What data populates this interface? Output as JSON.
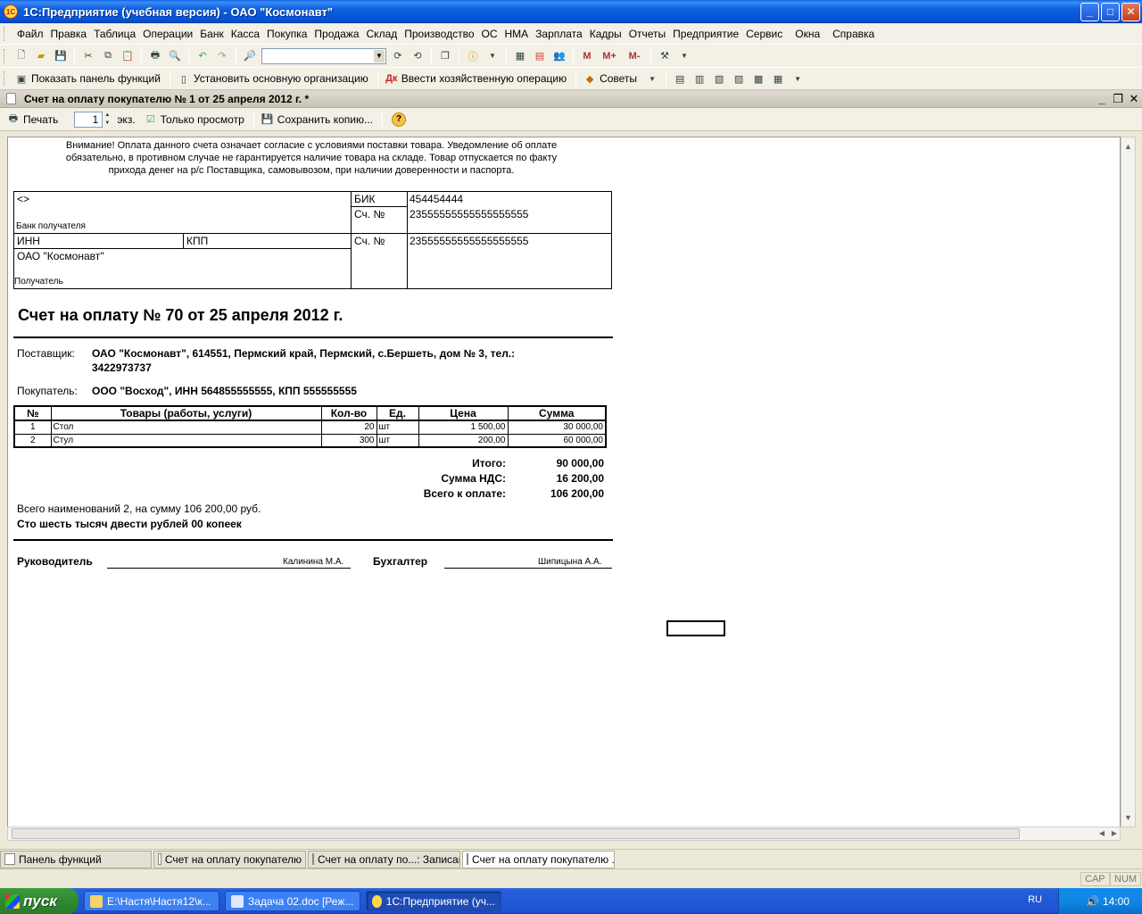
{
  "window": {
    "title": "1С:Предприятие (учебная версия) - ОАО \"Космонавт\"",
    "min": "_",
    "max": "□",
    "close": "✕"
  },
  "menu": [
    "Файл",
    "Правка",
    "Таблица",
    "Операции",
    "Банк",
    "Касса",
    "Покупка",
    "Продажа",
    "Склад",
    "Производство",
    "ОС",
    "НМА",
    "Зарплата",
    "Кадры",
    "Отчеты",
    "Предприятие",
    "Сервис",
    "Окна",
    "Справка"
  ],
  "toolbar2": {
    "show_panel": "Показать панель функций",
    "set_org": "Установить основную организацию",
    "enter_op": "Ввести хозяйственную операцию",
    "tips": "Советы"
  },
  "toolbar1": {
    "m": "M",
    "mplus": "M+",
    "mminus": "M-"
  },
  "doc": {
    "title": "Счет на оплату покупателю № 1 от 25 апреля 2012 г. *",
    "print": "Печать",
    "copies": "1",
    "copies_unit": "экз.",
    "readonly": "Только просмотр",
    "save_copy": "Сохранить копию...",
    "help": "?"
  },
  "invoice": {
    "notice": [
      "Внимание! Оплата данного счета означает согласие с условиями поставки товара. Уведомление об оплате",
      "обязательно, в противном случае не гарантируется наличие товара на складе. Товар отпускается по факту",
      "прихода денег на р/с Поставщика, самовывозом, при наличии доверенности и паспорта."
    ],
    "bank": {
      "bank_name": "<>",
      "bank_label": "Банк получателя",
      "bik_label": "БИК",
      "bik": "454454444",
      "acc_label": "Сч. №",
      "corr_acc": "23555555555555555555",
      "inn_label": "ИНН",
      "kpp_label": "КПП",
      "recipient_name": "ОАО \"Космонавт\"",
      "recipient_label": "Получатель",
      "acc_label2": "Сч. №",
      "acc": "23555555555555555555"
    },
    "title": "Счет на оплату № 70 от 25 апреля 2012 г.",
    "supplier_label": "Поставщик:",
    "supplier_line1": "ОАО \"Космонавт\", 614551, Пермский край, Пермский, с.Бершеть, дом № 3, тел.:",
    "supplier_line2": "3422973737",
    "buyer_label": "Покупатель:",
    "buyer": "ООО \"Восход\", ИНН 564855555555, КПП 555555555",
    "columns": [
      "№",
      "Товары (работы, услуги)",
      "Кол-во",
      "Ед.",
      "Цена",
      "Сумма"
    ],
    "rows": [
      [
        "1",
        "Стол",
        "20",
        "шт",
        "1 500,00",
        "30 000,00"
      ],
      [
        "2",
        "Стул",
        "300",
        "шт",
        "200,00",
        "60 000,00"
      ]
    ],
    "total_label": "Итого:",
    "total": "90 000,00",
    "vat_label": "Сумма НДС:",
    "vat": "16 200,00",
    "grand_label": "Всего к оплате:",
    "grand": "106 200,00",
    "summary": "Всего наименований 2, на сумму 106 200,00 руб.",
    "in_words": "Сто шесть тысяч двести рублей 00 копеек",
    "head_label": "Руководитель",
    "head_name": "Калинина М.А.",
    "acct_label": "Бухгалтер",
    "acct_name": "Шипицына А.А."
  },
  "tabs": [
    {
      "label": "Панель функций"
    },
    {
      "label": "Счет на оплату покупателю"
    },
    {
      "label": "Счет на оплату по...: Записан"
    },
    {
      "label": "Счет на оплату покупателю ..."
    }
  ],
  "status": {
    "cap": "CAP",
    "num": "NUM"
  },
  "taskbar": {
    "start": "пуск",
    "tasks": [
      {
        "label": "E:\\Настя\\Настя12\\к..."
      },
      {
        "label": "Задача 02.doc [Реж..."
      },
      {
        "label": "1С:Предприятие (уч..."
      }
    ],
    "lang": "RU",
    "clock": "14:00"
  }
}
